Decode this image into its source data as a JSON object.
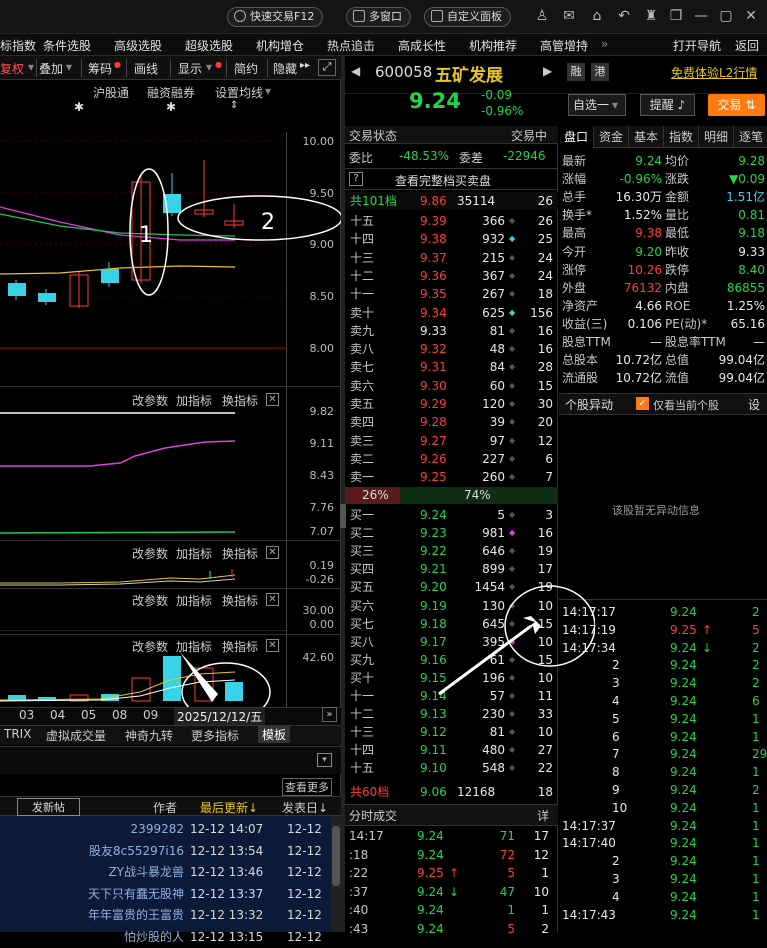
{
  "topbar": {
    "quick_trade": "快速交易F12",
    "multi_window": "多窗口",
    "custom_panel": "自定义面板"
  },
  "menu": [
    "标指数",
    "条件选股",
    "高级选股",
    "超级选股",
    "机构增仓",
    "热点追击",
    "高成长性",
    "机构推荐",
    "高管增持",
    "»",
    "打开导航",
    "返回"
  ],
  "left": {
    "toolbar": [
      "复权",
      "叠加",
      "筹码",
      "画线",
      "显示",
      "简约",
      "隐藏"
    ],
    "subtabs": [
      "沪股通",
      "融资融券",
      "设置均线"
    ],
    "main_axis": [
      "10.00",
      "9.50",
      "9.00",
      "8.50",
      "8.00"
    ],
    "annotations": [
      "1",
      "2"
    ],
    "ind_header": [
      "改参数",
      "加指标",
      "换指标"
    ],
    "ind1_axis": [
      "9.82",
      "9.11",
      "8.43",
      "7.76",
      "7.07"
    ],
    "ind2_axis": [
      "0.19",
      "-0.26"
    ],
    "ind3_axis": [
      "30.00",
      "0.00"
    ],
    "ind4_axis": [
      "42.60"
    ],
    "xaxis": [
      "03",
      "04",
      "05",
      "08",
      "09"
    ],
    "date_badge": "2025/12/12/五",
    "bottom_tabs": [
      "TRIX",
      "虚拟成交量",
      "神奇九转",
      "更多指标",
      "模板"
    ],
    "forum": {
      "more": "查看更多",
      "new_post": "发新帖",
      "col_author": "作者",
      "col_updated": "最后更新↓",
      "col_posted": "发表日↓",
      "posts": [
        {
          "author": "2399282",
          "updated": "12-12 14:07",
          "posted": "12-12"
        },
        {
          "author": "股友8c55297i16",
          "updated": "12-12 13:54",
          "posted": "12-12"
        },
        {
          "author": "ZY战斗暴龙兽",
          "updated": "12-12 13:46",
          "posted": "12-12"
        },
        {
          "author": "天下只有蠢无股神",
          "updated": "12-12 13:37",
          "posted": "12-12"
        },
        {
          "author": "年年富贵的王富贵",
          "updated": "12-12 13:32",
          "posted": "12-12"
        },
        {
          "author": "怕炒股的人",
          "updated": "12-12 13:15",
          "posted": "12-12"
        }
      ]
    }
  },
  "stock": {
    "code": "600058",
    "name": "五矿发展",
    "badge1": "融",
    "badge2": "港",
    "l2_link": "免费体验L2行情",
    "price": "9.24",
    "change": "-0.09",
    "change_pct": "-0.96%",
    "watch_btn": "自选一",
    "remind_btn": "提醒",
    "trade_btn": "交易"
  },
  "orderbook": {
    "status_label": "交易状态",
    "status_value": "交易中",
    "weibi_label": "委比",
    "weibi_value": "-48.53%",
    "weicha_label": "委差",
    "weicha_value": "-22946",
    "full_book": "查看完整档买卖盘",
    "ask_summary": {
      "label": "共101档",
      "price": "9.86",
      "vol": "35114",
      "count": "26"
    },
    "asks": [
      {
        "label": "十五",
        "price": "9.39",
        "vol": "366",
        "count": "26",
        "mark": ""
      },
      {
        "label": "十四",
        "price": "9.38",
        "vol": "932",
        "count": "25",
        "mark": "cyan"
      },
      {
        "label": "十三",
        "price": "9.37",
        "vol": "215",
        "count": "24",
        "mark": ""
      },
      {
        "label": "十二",
        "price": "9.36",
        "vol": "367",
        "count": "24",
        "mark": ""
      },
      {
        "label": "十一",
        "price": "9.35",
        "vol": "267",
        "count": "18",
        "mark": ""
      },
      {
        "label": "卖十",
        "price": "9.34",
        "vol": "625",
        "count": "156",
        "mark": "cyan"
      },
      {
        "label": "卖九",
        "price": "9.33",
        "vol": "81",
        "count": "16",
        "mark": ""
      },
      {
        "label": "卖八",
        "price": "9.32",
        "vol": "48",
        "count": "16",
        "mark": ""
      },
      {
        "label": "卖七",
        "price": "9.31",
        "vol": "84",
        "count": "28",
        "mark": ""
      },
      {
        "label": "卖六",
        "price": "9.30",
        "vol": "60",
        "count": "15",
        "mark": ""
      },
      {
        "label": "卖五",
        "price": "9.29",
        "vol": "120",
        "count": "30",
        "mark": ""
      },
      {
        "label": "卖四",
        "price": "9.28",
        "vol": "39",
        "count": "20",
        "mark": ""
      },
      {
        "label": "卖三",
        "price": "9.27",
        "vol": "97",
        "count": "12",
        "mark": ""
      },
      {
        "label": "卖二",
        "price": "9.26",
        "vol": "227",
        "count": "6",
        "mark": ""
      },
      {
        "label": "卖一",
        "price": "9.25",
        "vol": "260",
        "count": "7",
        "mark": ""
      }
    ],
    "ratio_sell": "26%",
    "ratio_buy": "74%",
    "ratio_sell_frac": 0.26,
    "bids": [
      {
        "label": "买一",
        "price": "9.24",
        "vol": "5",
        "count": "3",
        "mark": ""
      },
      {
        "label": "买二",
        "price": "9.23",
        "vol": "981",
        "count": "16",
        "mark": "magenta"
      },
      {
        "label": "买三",
        "price": "9.22",
        "vol": "646",
        "count": "19",
        "mark": ""
      },
      {
        "label": "买四",
        "price": "9.21",
        "vol": "899",
        "count": "17",
        "mark": ""
      },
      {
        "label": "买五",
        "price": "9.20",
        "vol": "1454",
        "count": "19",
        "mark": ""
      },
      {
        "label": "买六",
        "price": "9.19",
        "vol": "130",
        "count": "10",
        "mark": ""
      },
      {
        "label": "买七",
        "price": "9.18",
        "vol": "645",
        "count": "15",
        "mark": ""
      },
      {
        "label": "买八",
        "price": "9.17",
        "vol": "395",
        "count": "10",
        "mark": "magenta"
      },
      {
        "label": "买九",
        "price": "9.16",
        "vol": "61",
        "count": "15",
        "mark": ""
      },
      {
        "label": "买十",
        "price": "9.15",
        "vol": "196",
        "count": "10",
        "mark": ""
      },
      {
        "label": "十一",
        "price": "9.14",
        "vol": "57",
        "count": "11",
        "mark": ""
      },
      {
        "label": "十二",
        "price": "9.13",
        "vol": "230",
        "count": "33",
        "mark": ""
      },
      {
        "label": "十三",
        "price": "9.12",
        "vol": "81",
        "count": "10",
        "mark": ""
      },
      {
        "label": "十四",
        "price": "9.11",
        "vol": "480",
        "count": "27",
        "mark": ""
      },
      {
        "label": "十五",
        "price": "9.10",
        "vol": "548",
        "count": "22",
        "mark": ""
      }
    ],
    "bid_summary": {
      "label": "共60档",
      "price": "9.06",
      "vol": "12168",
      "count": "18"
    },
    "ticks_header": "分时成交",
    "ticks_detail": "详",
    "ticks": [
      {
        "time": "14:17",
        "price": "9.24",
        "vol": "71",
        "n": "17",
        "dir": ""
      },
      {
        "time": ":18",
        "price": "9.24",
        "vol": "72",
        "n": "12",
        "dir": ""
      },
      {
        "time": ":22",
        "price": "9.25",
        "vol": "5",
        "n": "1",
        "dir": "up"
      },
      {
        "time": ":37",
        "price": "9.24",
        "vol": "47",
        "n": "10",
        "dir": "down"
      },
      {
        "time": ":40",
        "price": "9.24",
        "vol": "1",
        "n": "1",
        "dir": ""
      },
      {
        "time": ":43",
        "price": "9.24",
        "vol": "5",
        "n": "2",
        "dir": ""
      }
    ]
  },
  "quote": {
    "tabs": [
      "盘口",
      "资金",
      "基本",
      "指数",
      "明细",
      "逐笔"
    ],
    "rows": [
      [
        {
          "l": "最新",
          "v": "9.24",
          "c": "green"
        },
        {
          "l": "均价",
          "v": "9.28",
          "c": "green"
        }
      ],
      [
        {
          "l": "涨幅",
          "v": "-0.96%",
          "c": "green"
        },
        {
          "l": "涨跌",
          "v": "▼0.09",
          "c": "green"
        }
      ],
      [
        {
          "l": "总手",
          "v": "16.30万",
          "c": "white"
        },
        {
          "l": "金额",
          "v": "1.51亿",
          "c": "cyan"
        }
      ],
      [
        {
          "l": "换手*",
          "v": "1.52%",
          "c": "white"
        },
        {
          "l": "量比",
          "v": "0.81",
          "c": "green"
        }
      ],
      [
        {
          "l": "最高",
          "v": "9.38",
          "c": "red"
        },
        {
          "l": "最低",
          "v": "9.18",
          "c": "green"
        }
      ],
      [
        {
          "l": "今开",
          "v": "9.20",
          "c": "green"
        },
        {
          "l": "昨收",
          "v": "9.33",
          "c": "white"
        }
      ],
      [
        {
          "l": "涨停",
          "v": "10.26",
          "c": "red"
        },
        {
          "l": "跌停",
          "v": "8.40",
          "c": "green"
        }
      ],
      [
        {
          "l": "外盘",
          "v": "76132",
          "c": "red"
        },
        {
          "l": "内盘",
          "v": "86855",
          "c": "green"
        }
      ],
      [
        {
          "l": "净资产",
          "v": "4.66",
          "c": "white"
        },
        {
          "l": "ROE",
          "v": "1.25%",
          "c": "white"
        }
      ],
      [
        {
          "l": "收益(三)",
          "v": "0.106",
          "c": "white"
        },
        {
          "l": "PE(动)*",
          "v": "65.16",
          "c": "white"
        }
      ],
      [
        {
          "l": "股息TTM",
          "v": "—",
          "c": "white"
        },
        {
          "l": "股息率TTM",
          "v": "—",
          "c": "white"
        }
      ],
      [
        {
          "l": "总股本",
          "v": "10.72亿",
          "c": "white"
        },
        {
          "l": "总值",
          "v": "99.04亿",
          "c": "white"
        }
      ],
      [
        {
          "l": "流通股",
          "v": "10.72亿",
          "c": "white"
        },
        {
          "l": "流值",
          "v": "99.04亿",
          "c": "white"
        }
      ]
    ],
    "anomaly_title": "个股异动",
    "anomaly_check": "仅看当前个股",
    "anomaly_settings": "设",
    "anomaly_empty": "该股暂无异动信息",
    "trades": [
      {
        "time": "14:17:17",
        "price": "9.24",
        "vol": "2",
        "dir": ""
      },
      {
        "time": "14:17:19",
        "price": "9.25",
        "vol": "5",
        "dir": "up"
      },
      {
        "time": "14:17:34",
        "price": "9.24",
        "vol": "2",
        "dir": "down"
      },
      {
        "time": "2",
        "price": "9.24",
        "vol": "2",
        "dir": ""
      },
      {
        "time": "3",
        "price": "9.24",
        "vol": "2",
        "dir": ""
      },
      {
        "time": "4",
        "price": "9.24",
        "vol": "6",
        "dir": ""
      },
      {
        "time": "5",
        "price": "9.24",
        "vol": "1",
        "dir": ""
      },
      {
        "time": "6",
        "price": "9.24",
        "vol": "1",
        "dir": ""
      },
      {
        "time": "7",
        "price": "9.24",
        "vol": "29",
        "dir": ""
      },
      {
        "time": "8",
        "price": "9.24",
        "vol": "1",
        "dir": ""
      },
      {
        "time": "9",
        "price": "9.24",
        "vol": "2",
        "dir": ""
      },
      {
        "time": "10",
        "price": "9.24",
        "vol": "1",
        "dir": ""
      },
      {
        "time": "14:17:37",
        "price": "9.24",
        "vol": "1",
        "dir": ""
      },
      {
        "time": "14:17:40",
        "price": "9.24",
        "vol": "1",
        "dir": ""
      },
      {
        "time": "2",
        "price": "9.24",
        "vol": "1",
        "dir": ""
      },
      {
        "time": "3",
        "price": "9.24",
        "vol": "1",
        "dir": ""
      },
      {
        "time": "4",
        "price": "9.24",
        "vol": "1",
        "dir": ""
      },
      {
        "time": "14:17:43",
        "price": "9.24",
        "vol": "1",
        "dir": ""
      }
    ]
  },
  "colors": {
    "up": "#ff3b3b",
    "down": "#22d44a",
    "accent": "#e9c51f",
    "candle_down": "#39d3e8"
  }
}
